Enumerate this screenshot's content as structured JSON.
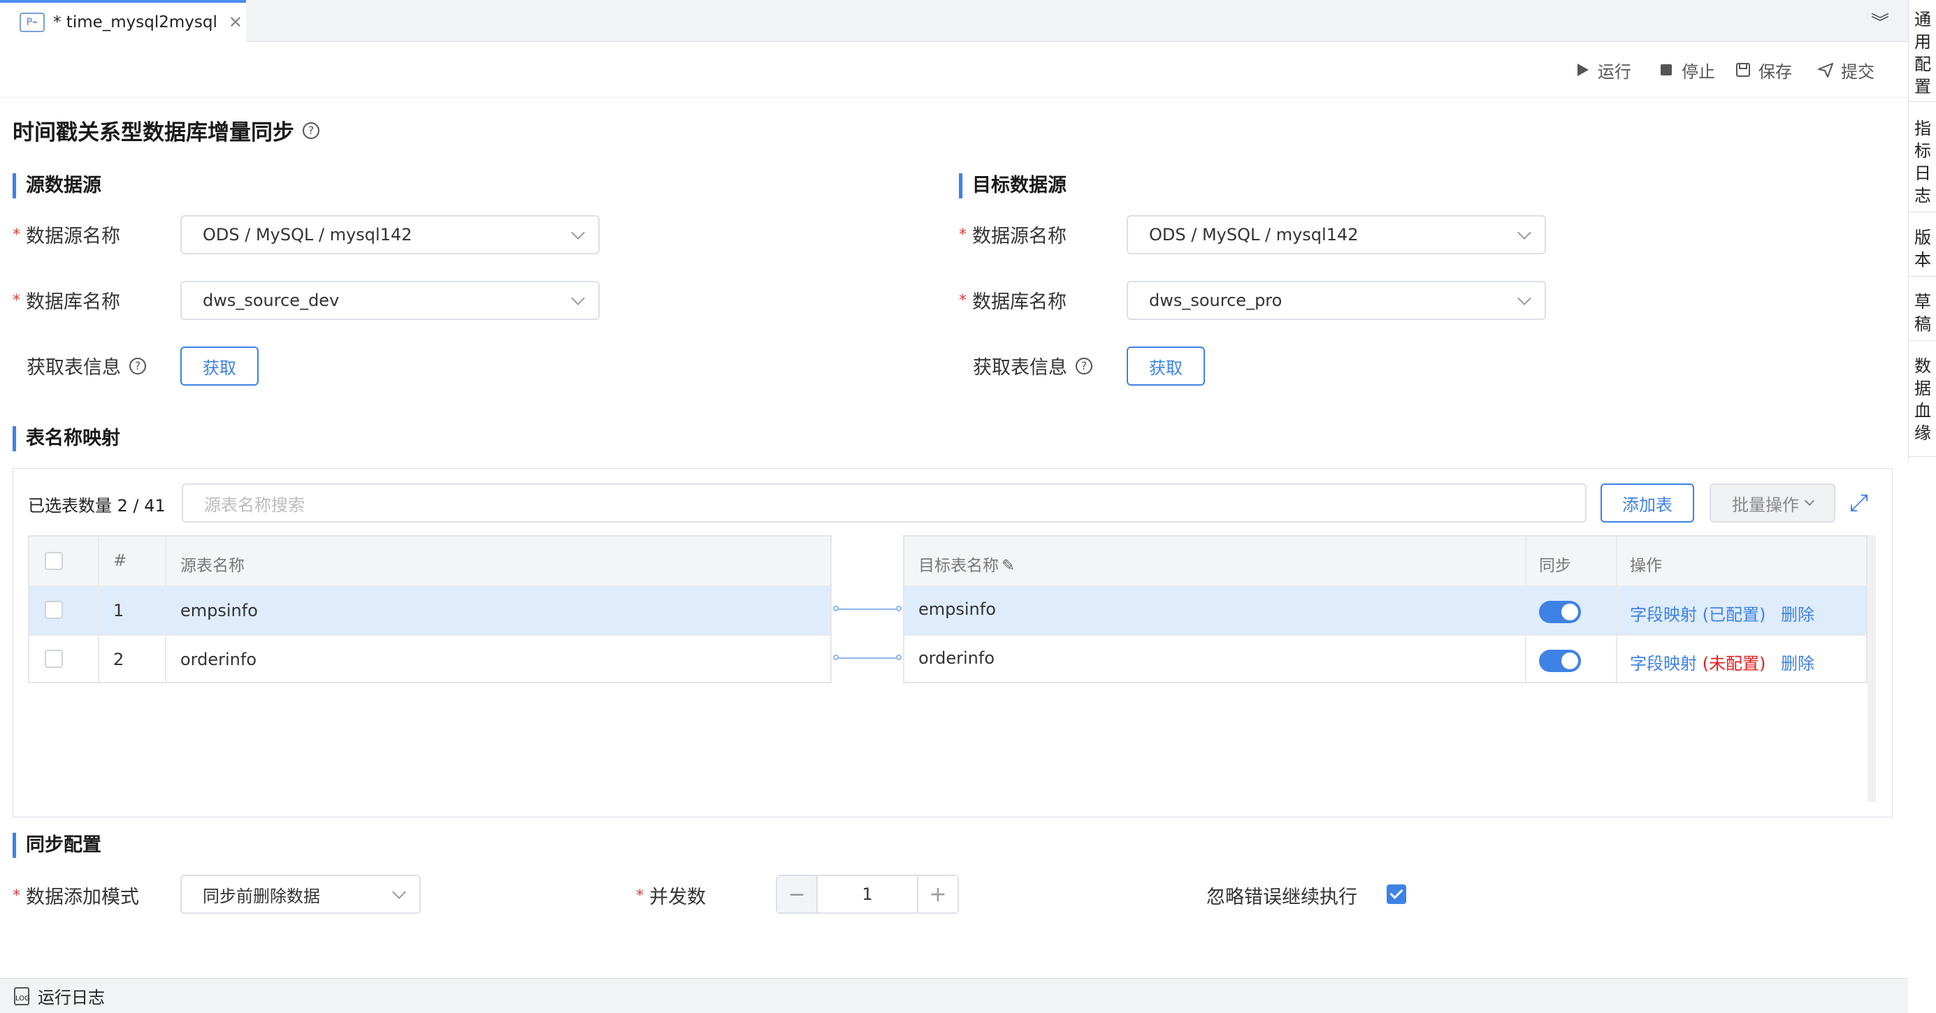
{
  "tab": {
    "icon": "P⌁",
    "title": "* time_mysql2mysql",
    "close": "✕"
  },
  "collapse_icon": "︾",
  "right_sidebar": [
    "通用配置",
    "指标日志",
    "版本",
    "草稿",
    "数据血缘"
  ],
  "toolbar": {
    "run": "运行",
    "stop": "停止",
    "save": "保存",
    "submit": "提交"
  },
  "page_title": "时间戳关系型数据库增量同步",
  "help_glyph": "?",
  "source": {
    "section": "源数据源",
    "ds_label": "数据源名称",
    "ds_value": "ODS / MySQL / mysql142",
    "db_label": "数据库名称",
    "db_value": "dws_source_dev",
    "fetch_label": "获取表信息",
    "fetch_button": "获取"
  },
  "target": {
    "section": "目标数据源",
    "ds_label": "数据源名称",
    "ds_value": "ODS / MySQL / mysql142",
    "db_label": "数据库名称",
    "db_value": "dws_source_pro",
    "fetch_label": "获取表信息",
    "fetch_button": "获取"
  },
  "mapping": {
    "section": "表名称映射",
    "selected_count": "已选表数量 2 / 41",
    "search_placeholder": "源表名称搜索",
    "add_table": "添加表",
    "batch": "批量操作",
    "expand_icon": "⤢",
    "headers": {
      "index": "#",
      "source": "源表名称",
      "target": "目标表名称",
      "sync": "同步",
      "ops": "操作"
    },
    "edit_icon": "✎",
    "rows": [
      {
        "index": "1",
        "source": "empsinfo",
        "target": "empsinfo",
        "field_map": "字段映射 ",
        "status": "(已配置)",
        "delete": "删除"
      },
      {
        "index": "2",
        "source": "orderinfo",
        "target": "orderinfo",
        "field_map": "字段映射 ",
        "status": "(未配置)",
        "delete": "删除"
      }
    ]
  },
  "sync_config": {
    "section": "同步配置",
    "mode_label": "数据添加模式",
    "mode_value": "同步前删除数据",
    "concurrency_label": "并发数",
    "concurrency_value": "1",
    "minus": "−",
    "plus": "+",
    "ignore_label": "忽略错误继续执行"
  },
  "log": {
    "icon": "LOG",
    "label": "运行日志"
  },
  "colors": {
    "accent": "#3e82e5",
    "required": "#e53935",
    "unconfigured": "#e02020"
  }
}
